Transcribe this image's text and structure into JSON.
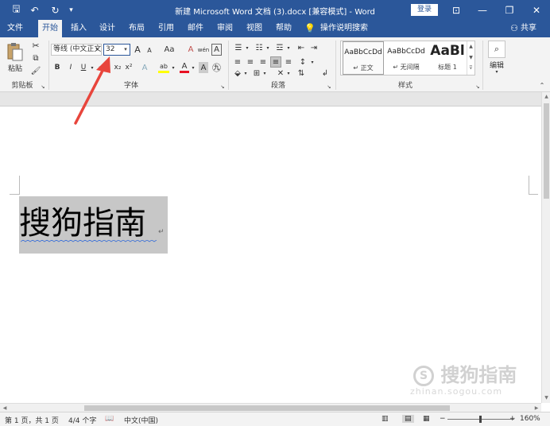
{
  "window": {
    "title": "新建 Microsoft Word 文档 (3).docx [兼容模式] - Word",
    "login_label": "登录",
    "minimize": "—",
    "restore": "❐",
    "close": "✕",
    "ribbon_display": "⊡"
  },
  "quick_access": {
    "save": "🖫",
    "undo": "↶",
    "redo": "↻",
    "customize": "▾"
  },
  "tabs": [
    "文件",
    "开始",
    "插入",
    "设计",
    "布局",
    "引用",
    "邮件",
    "审阅",
    "视图",
    "帮助"
  ],
  "active_tab": "开始",
  "tell_me": "操作说明搜索",
  "share_label": "共享",
  "ribbon": {
    "clipboard": {
      "paste_label": "粘贴",
      "group_label": "剪贴板"
    },
    "font": {
      "font_name": "等线 (中文正文)",
      "font_size": "32",
      "group_label": "字体",
      "bold": "B",
      "italic": "I",
      "underline": "U",
      "strike": "abc",
      "subscript": "x₂",
      "superscript": "x²",
      "grow": "A",
      "shrink": "A",
      "change_case": "Aa",
      "clear": "A",
      "phonetic": "wén",
      "border": "A",
      "effects": "A",
      "highlight": "ab",
      "font_color": "A",
      "char_shade": "A",
      "enclose": "㊈"
    },
    "paragraph": {
      "group_label": "段落"
    },
    "styles": {
      "group_label": "样式",
      "items": [
        {
          "sample": "AaBbCcDd",
          "name": "↵ 正文"
        },
        {
          "sample": "AaBbCcDd",
          "name": "↵ 无间隔"
        },
        {
          "sample": "AaBl",
          "name": "标题 1"
        }
      ]
    },
    "editing": {
      "label": "编辑"
    }
  },
  "document": {
    "text": "搜狗指南",
    "paragraph_mark": "↵"
  },
  "status": {
    "page": "第 1 页，共 1 页",
    "words": "4/4 个字",
    "language": "中文(中国)",
    "zoom": "160%",
    "zoom_minus": "−",
    "zoom_plus": "+"
  },
  "watermark": {
    "text": "搜狗指南",
    "url": "zhinan.sogou.com"
  },
  "colors": {
    "accent": "#2b579a",
    "annotation": "#e8453c",
    "selection": "#c7c7c7",
    "highlight": "#ffff00",
    "font_color": "#e81123"
  }
}
